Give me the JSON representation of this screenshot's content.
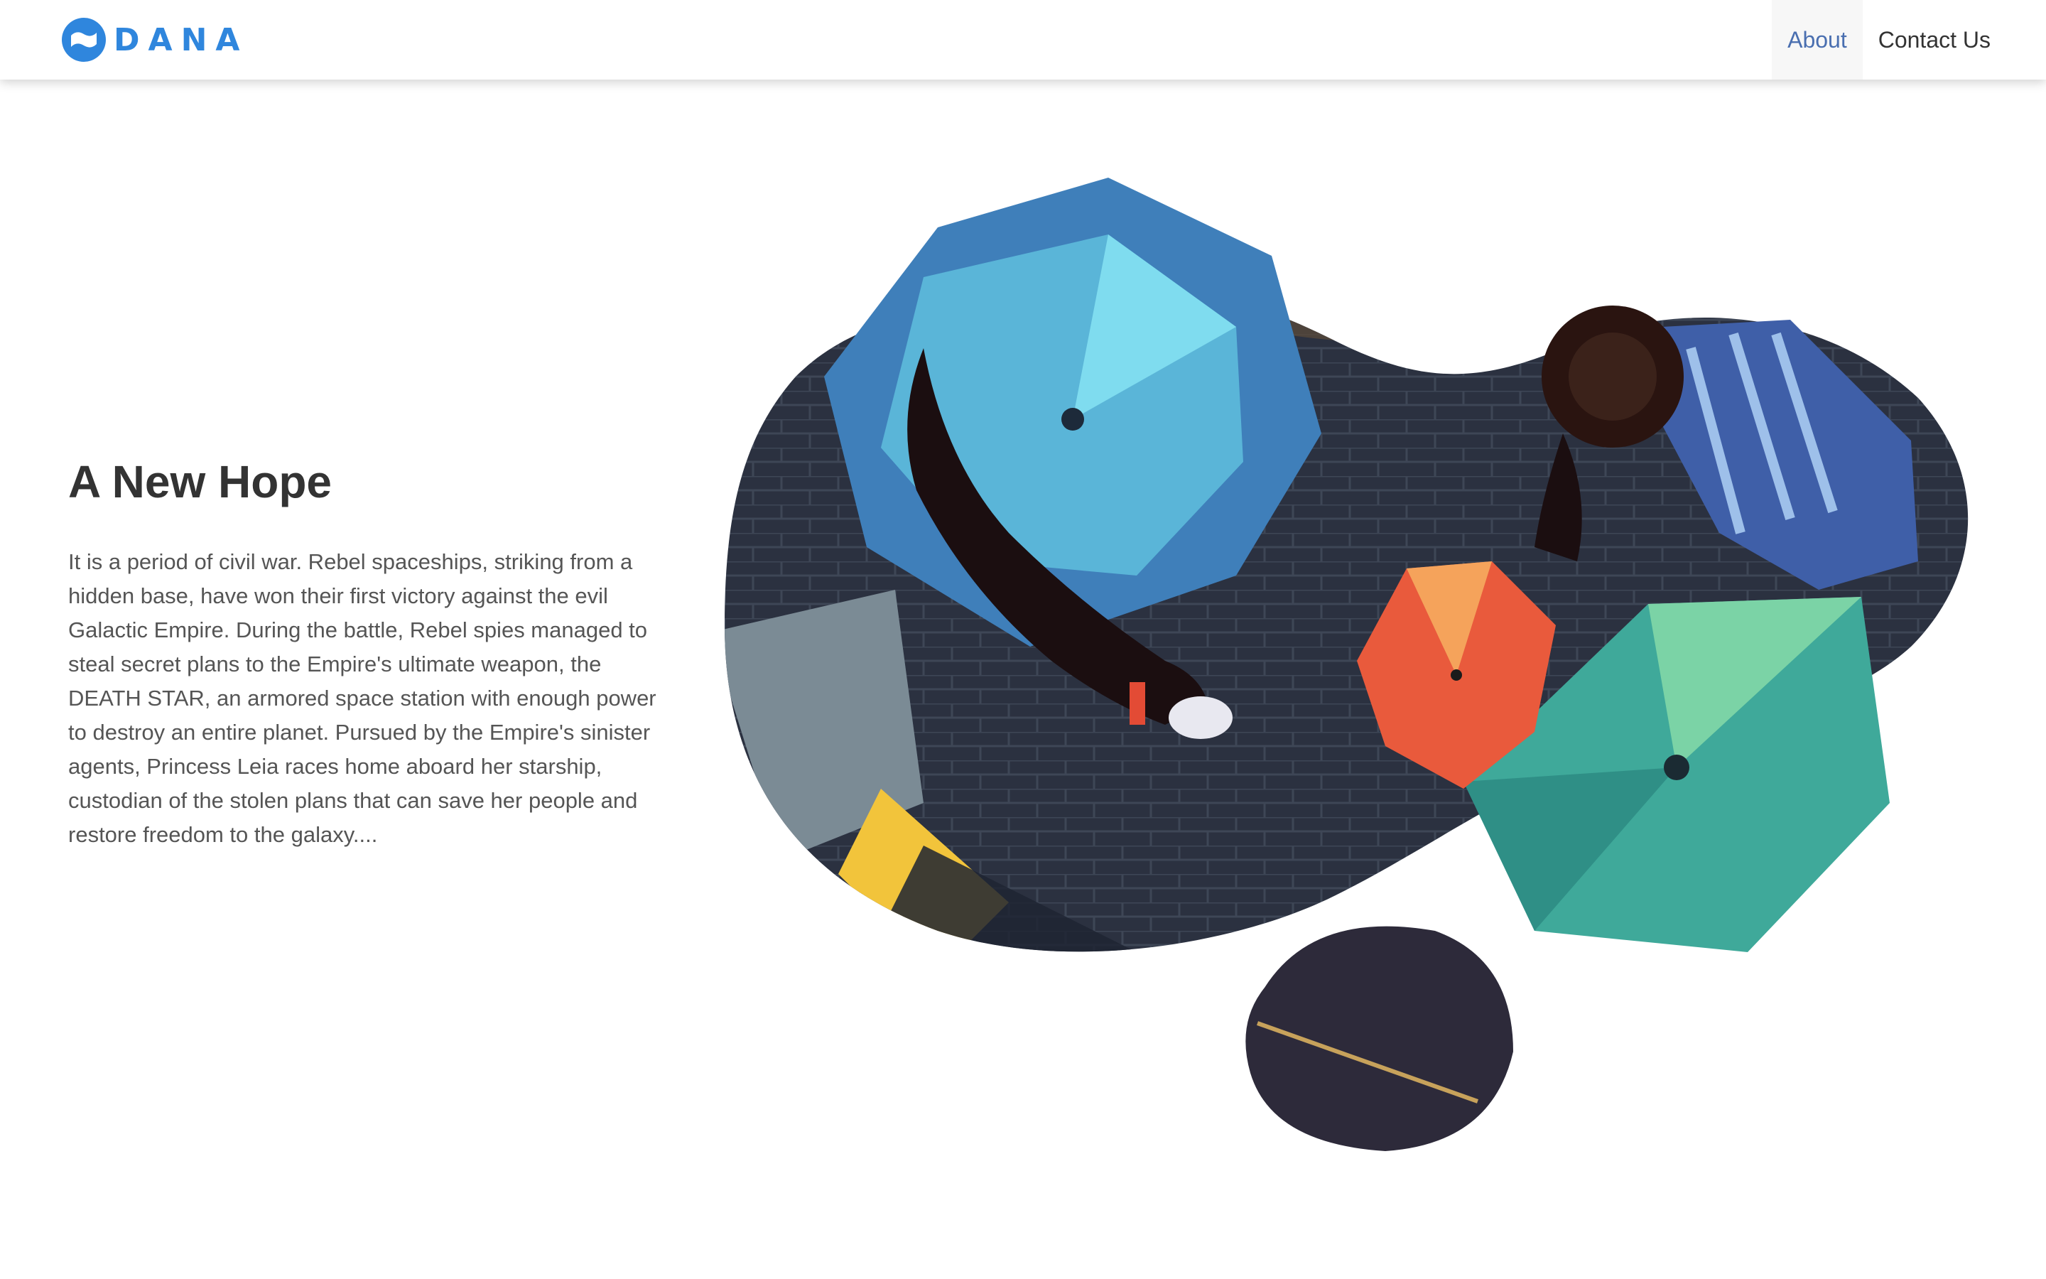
{
  "brand": {
    "name": "DANA",
    "color": "#2f86dd"
  },
  "nav": {
    "items": [
      {
        "label": "About",
        "active": true
      },
      {
        "label": "Contact Us",
        "active": false
      }
    ]
  },
  "hero": {
    "title": "A New Hope",
    "body": "It is a period of civil war. Rebel spaceships, striking from a hidden base, have won their first victory against the evil Galactic Empire. During the battle, Rebel spies managed to steal secret plans to the Empire's ultimate weapon, the DEATH STAR, an armored space station with enough power to destroy an entire planet. Pursued by the Empire's sinister agents, Princess Leia races home aboard her starship, custodian of the stolen plans that can save her people and restore freedom to the galaxy...."
  }
}
